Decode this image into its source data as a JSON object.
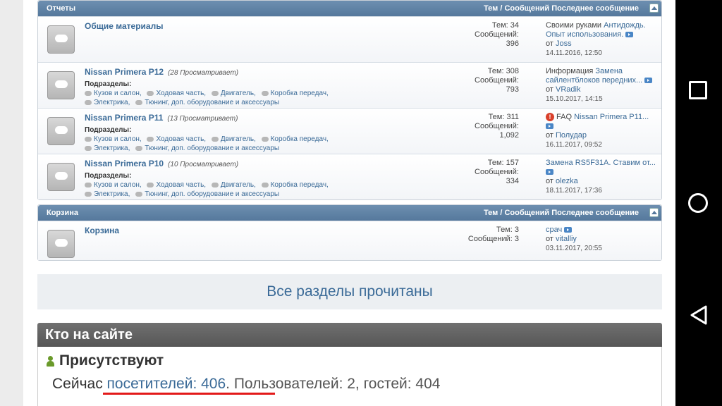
{
  "sections": [
    {
      "title": "Отчеты",
      "cols": "Тем / Сообщений  Последнее сообщение",
      "forums": [
        {
          "title": "Общие материалы",
          "viewers": "",
          "sub_label": "",
          "sub_line1": [],
          "sub_line2": [],
          "stats": [
            "Тем: 34",
            "Сообщений:",
            "396"
          ],
          "last": {
            "warn": false,
            "prefix": "Своими руками ",
            "link1": "Антидождь.",
            "link2": "Опыт использования.",
            "author_prefix": "от ",
            "author": "Joss",
            "date": "14.11.2016, 12:50"
          }
        },
        {
          "title": "Nissan Primera P12",
          "viewers": "(28 Просматривает)",
          "sub_label": "Подразделы:",
          "sub_line1": [
            "Кузов и салон,",
            "Ходовая часть,",
            "Двигатель,",
            "Коробка передач,"
          ],
          "sub_line2": [
            "Электрика,",
            "Тюнинг, доп. оборудование и аксессуары"
          ],
          "stats": [
            "Тем: 308",
            "Сообщений:",
            "793"
          ],
          "last": {
            "warn": false,
            "prefix": "Информация ",
            "link1": "Замена",
            "link2": "сайлентблоков передних...",
            "author_prefix": "от ",
            "author": "VRadik",
            "date": "15.10.2017, 14:15"
          }
        },
        {
          "title": "Nissan Primera P11",
          "viewers": "(13 Просматривает)",
          "sub_label": "Подразделы:",
          "sub_line1": [
            "Кузов и салон,",
            "Ходовая часть,",
            "Двигатель,",
            "Коробка передач,"
          ],
          "sub_line2": [
            "Электрика,",
            "Тюнинг, доп. оборудование и аксессуары"
          ],
          "stats": [
            "Тем: 311",
            "Сообщений:",
            "1,092"
          ],
          "last": {
            "warn": true,
            "prefix": "FAQ ",
            "link1": "Nissan Primera P11...",
            "link2": "",
            "author_prefix": "от ",
            "author": "Полудар",
            "date": "16.11.2017, 09:52"
          }
        },
        {
          "title": "Nissan Primera P10",
          "viewers": "(10 Просматривает)",
          "sub_label": "Подразделы:",
          "sub_line1": [
            "Кузов и салон,",
            "Ходовая часть,",
            "Двигатель,",
            "Коробка передач,"
          ],
          "sub_line2": [
            "Электрика,",
            "Тюнинг, доп. оборудование и аксессуары"
          ],
          "stats": [
            "Тем: 157",
            "Сообщений:",
            "334"
          ],
          "last": {
            "warn": false,
            "prefix": "",
            "link1": "Замена RS5F31A. Ставим от...",
            "link2": "",
            "author_prefix": "от ",
            "author": "olezka",
            "date": "18.11.2017, 17:36"
          }
        }
      ]
    },
    {
      "title": "Корзина",
      "cols": "Тем / Сообщений  Последнее сообщение",
      "forums": [
        {
          "title": "Корзина",
          "viewers": "",
          "sub_label": "",
          "sub_line1": [],
          "sub_line2": [],
          "stats": [
            "Тем: 3",
            "Сообщений: 3",
            ""
          ],
          "last": {
            "warn": false,
            "prefix": "",
            "link1": "срач",
            "link2": "",
            "author_prefix": "от ",
            "author": "vitalliy",
            "date": "03.11.2017, 20:55"
          }
        }
      ]
    }
  ],
  "all_read": "Все разделы прочитаны",
  "online": {
    "header": "Кто на сайте",
    "present": "Присутствуют",
    "now": "Сейчас ",
    "visitors_link": "посетителей: 406",
    "rest": ". Пользователей: 2, гостей: 404"
  },
  "colors": {
    "link": "#3a6a97",
    "header_bg": "#5f82a6",
    "underline": "#e31a1a"
  },
  "icons": {
    "nav_recents": "square-icon",
    "nav_home": "circle-icon",
    "nav_back": "back-triangle-icon"
  }
}
